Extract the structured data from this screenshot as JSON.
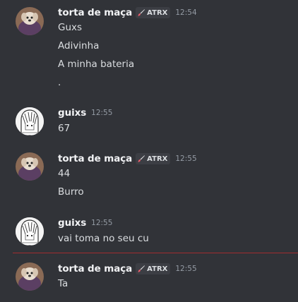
{
  "messages": [
    {
      "author": "torta de maça",
      "tag": "ATRX",
      "time": "12:54",
      "lines": [
        "Guxs",
        "Adivinha",
        "A minha bateria",
        "."
      ]
    },
    {
      "author": "guixs",
      "time": "12:55",
      "lines": [
        "67"
      ]
    },
    {
      "author": "torta de maça",
      "tag": "ATRX",
      "time": "12:55",
      "lines": [
        "44",
        "Burro"
      ]
    },
    {
      "author": "guixs",
      "time": "12:55",
      "lines": [
        "vai toma no seu cu"
      ]
    },
    {
      "author": "torta de maça",
      "tag": "ATRX",
      "time": "12:55",
      "lines": [
        "Ta"
      ]
    }
  ],
  "colors": {
    "background": "#313338",
    "username": "#f2f3f5",
    "text": "#dbdee1",
    "timestamp": "#949ba4",
    "new_messages_divider": "#a12d2f"
  },
  "icons": {
    "tag_icon": "brush-icon"
  }
}
